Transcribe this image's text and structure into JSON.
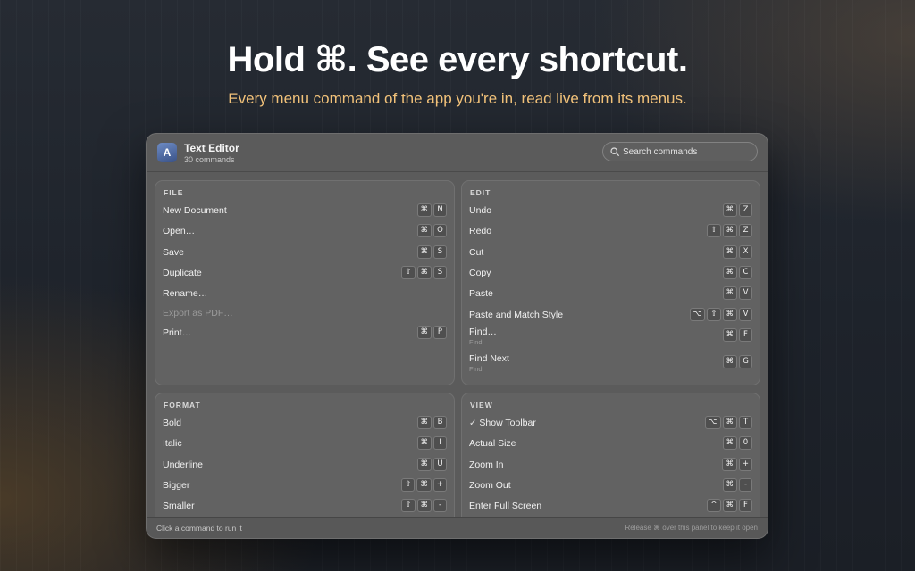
{
  "hero": {
    "title": "Hold ⌘. See every shortcut.",
    "subtitle": "Every menu command of the app you're in, read live from its menus."
  },
  "panel": {
    "app_icon_letter": "A",
    "app_name": "Text Editor",
    "command_count": "30 commands",
    "search": {
      "placeholder": "Search commands",
      "icon": "search-icon"
    },
    "footer": {
      "left": "Click a command to run it",
      "right": "Release ⌘ over this panel to keep it open"
    },
    "sections": {
      "file": {
        "title": "FILE",
        "items": [
          {
            "label": "New Document",
            "keys": [
              "⌘",
              "N"
            ]
          },
          {
            "label": "Open…",
            "keys": [
              "⌘",
              "O"
            ]
          },
          {
            "label": "Save",
            "keys": [
              "⌘",
              "S"
            ]
          },
          {
            "label": "Duplicate",
            "keys": [
              "⇧",
              "⌘",
              "S"
            ]
          },
          {
            "label": "Rename…",
            "keys": []
          },
          {
            "label": "Export as PDF…",
            "keys": [],
            "disabled": true
          },
          {
            "label": "Print…",
            "keys": [
              "⌘",
              "P"
            ]
          }
        ]
      },
      "edit": {
        "title": "EDIT",
        "items": [
          {
            "label": "Undo",
            "keys": [
              "⌘",
              "Z"
            ]
          },
          {
            "label": "Redo",
            "keys": [
              "⇧",
              "⌘",
              "Z"
            ]
          },
          {
            "label": "Cut",
            "keys": [
              "⌘",
              "X"
            ]
          },
          {
            "label": "Copy",
            "keys": [
              "⌘",
              "C"
            ]
          },
          {
            "label": "Paste",
            "keys": [
              "⌘",
              "V"
            ]
          },
          {
            "label": "Paste and Match Style",
            "keys": [
              "⌥",
              "⇧",
              "⌘",
              "V"
            ]
          },
          {
            "label": "Find…",
            "sub": "Find",
            "keys": [
              "⌘",
              "F"
            ]
          },
          {
            "label": "Find Next",
            "sub": "Find",
            "keys": [
              "⌘",
              "G"
            ]
          }
        ]
      },
      "format": {
        "title": "FORMAT",
        "items": [
          {
            "label": "Bold",
            "keys": [
              "⌘",
              "B"
            ]
          },
          {
            "label": "Italic",
            "keys": [
              "⌘",
              "I"
            ]
          },
          {
            "label": "Underline",
            "keys": [
              "⌘",
              "U"
            ]
          },
          {
            "label": "Bigger",
            "keys": [
              "⇧",
              "⌘",
              "+"
            ]
          },
          {
            "label": "Smaller",
            "keys": [
              "⇧",
              "⌘",
              "-"
            ]
          }
        ]
      },
      "view": {
        "title": "VIEW",
        "items": [
          {
            "label": "Show Toolbar",
            "checked": true,
            "keys": [
              "⌥",
              "⌘",
              "T"
            ]
          },
          {
            "label": "Actual Size",
            "keys": [
              "⌘",
              "0"
            ]
          },
          {
            "label": "Zoom In",
            "keys": [
              "⌘",
              "+"
            ]
          },
          {
            "label": "Zoom Out",
            "keys": [
              "⌘",
              "-"
            ]
          },
          {
            "label": "Enter Full Screen",
            "keys": [
              "^",
              "⌘",
              "F"
            ]
          }
        ]
      }
    }
  },
  "colors": {
    "accent_subtitle": "#f2c27a",
    "panel_bg": "#5b5b5b",
    "section_bg": "#626262"
  }
}
